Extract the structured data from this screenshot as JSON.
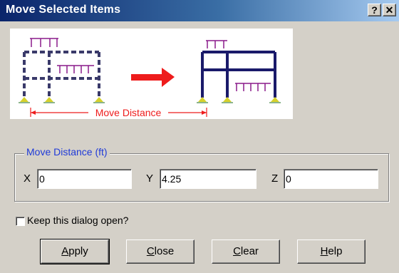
{
  "window": {
    "title": "Move Selected Items",
    "help_glyph": "?",
    "close_glyph": "✕"
  },
  "figure": {
    "caption": "Move Distance",
    "arrow_color": "#ee1c1c",
    "frame_color": "#1a1a6a",
    "load_color": "#8a1a8a",
    "support_color": "#d6d12a"
  },
  "group": {
    "legend": "Move Distance (ft)",
    "x_label": "X",
    "x_value": "0",
    "y_label": "Y",
    "y_value": "4.25",
    "z_label": "Z",
    "z_value": "0"
  },
  "keep_open": {
    "label": "Keep this dialog open?",
    "checked": false
  },
  "buttons": {
    "apply": {
      "prefix": "",
      "hotkey": "A",
      "rest": "pply"
    },
    "close": {
      "prefix": "",
      "hotkey": "C",
      "rest": "lose"
    },
    "clear": {
      "prefix": "",
      "hotkey": "C",
      "rest": "lear"
    },
    "help": {
      "prefix": "",
      "hotkey": "H",
      "rest": "elp"
    }
  }
}
